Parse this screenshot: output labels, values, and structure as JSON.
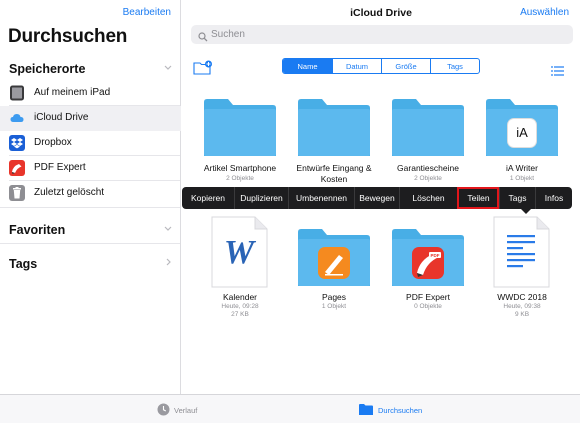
{
  "sidebar": {
    "edit_label": "Bearbeiten",
    "title": "Durchsuchen",
    "locations_header": "Speicherorte",
    "locations": [
      {
        "label": "Auf meinem iPad",
        "icon": "ipad-icon"
      },
      {
        "label": "iCloud Drive",
        "icon": "icloud-icon"
      },
      {
        "label": "Dropbox",
        "icon": "dropbox-icon"
      },
      {
        "label": "PDF Expert",
        "icon": "pdf-expert-icon"
      },
      {
        "label": "Zuletzt gelöscht",
        "icon": "trash-icon"
      }
    ],
    "favorites_header": "Favoriten",
    "tags_header": "Tags"
  },
  "main": {
    "title": "iCloud Drive",
    "select_label": "Auswählen",
    "search_placeholder": "Suchen",
    "sort_tabs": [
      "Name",
      "Datum",
      "Größe",
      "Tags"
    ],
    "sort_active": "Name",
    "files": [
      {
        "name": "Artikel Smartphone",
        "sub": "2 Objekte",
        "kind": "folder"
      },
      {
        "name": "Entwürfe Eingang & Kosten",
        "sub": "",
        "kind": "folder"
      },
      {
        "name": "Garantiescheine",
        "sub": "2 Objekte",
        "kind": "folder"
      },
      {
        "name": "iA Writer",
        "sub": "1 Objekt",
        "kind": "app-folder",
        "badge": "iA"
      },
      {
        "name": "Kalender",
        "sub": "Heute, 09:28",
        "size": "27 KB",
        "kind": "word-doc"
      },
      {
        "name": "Pages",
        "sub": "1 Objekt",
        "kind": "app-folder"
      },
      {
        "name": "PDF Expert",
        "sub": "0 Objekte",
        "kind": "app-folder"
      },
      {
        "name": "WWDC 2018",
        "sub": "Heute, 09:38",
        "size": "9 KB",
        "kind": "doc"
      }
    ]
  },
  "context_menu": {
    "items": [
      "Kopieren",
      "Duplizieren",
      "Umbenennen",
      "Bewegen",
      "Löschen",
      "Teilen",
      "Tags",
      "Infos"
    ],
    "highlighted": "Teilen"
  },
  "tabbar": {
    "items": [
      {
        "label": "Verlauf",
        "icon": "clock-icon",
        "active": false
      },
      {
        "label": "Durchsuchen",
        "icon": "folder-icon",
        "active": true
      }
    ]
  },
  "colors": {
    "accent": "#1a7bf2",
    "folder": "#5cb9ee",
    "folder_dark": "#48aee6",
    "highlight": "#e2161b",
    "menu_bg": "#1d1d1f"
  }
}
